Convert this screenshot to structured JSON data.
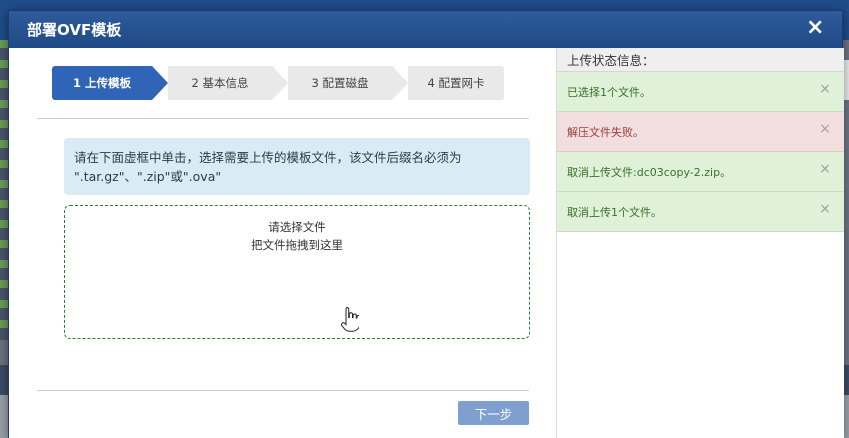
{
  "dialog": {
    "title": "部署OVF模板",
    "close_symbol": "×"
  },
  "wizard": {
    "steps": [
      {
        "label": "1 上传模板",
        "active": true
      },
      {
        "label": "2 基本信息",
        "active": false
      },
      {
        "label": "3 配置磁盘",
        "active": false
      },
      {
        "label": "4 配置网卡",
        "active": false
      }
    ]
  },
  "info_box": {
    "line1": "请在下面虚框中单击，选择需要上传的模板文件，该文件后缀名必须为",
    "line2": "\".tar.gz\"、\".zip\"或\".ova\""
  },
  "dropzone": {
    "line1": "请选择文件",
    "line2": "把文件拖拽到这里"
  },
  "footer": {
    "next_label": "下一步"
  },
  "status_panel": {
    "title": "上传状态信息：",
    "messages": [
      {
        "type": "success",
        "text": "已选择1个文件。"
      },
      {
        "type": "error",
        "text": "解压文件失败。"
      },
      {
        "type": "success",
        "text": "取消上传文件:dc03copy-2.zip。"
      },
      {
        "type": "success",
        "text": "取消上传1个文件。"
      }
    ],
    "dismiss_symbol": "×"
  },
  "colors": {
    "title_bar": "#1f4a86",
    "step_active": "#2f64b6",
    "next_button": "#7f9fcf",
    "success_bg": "#dff1d8",
    "error_bg": "#f2dede",
    "info_bg": "#d9ecf6",
    "dropzone_border": "#2e7d32"
  }
}
